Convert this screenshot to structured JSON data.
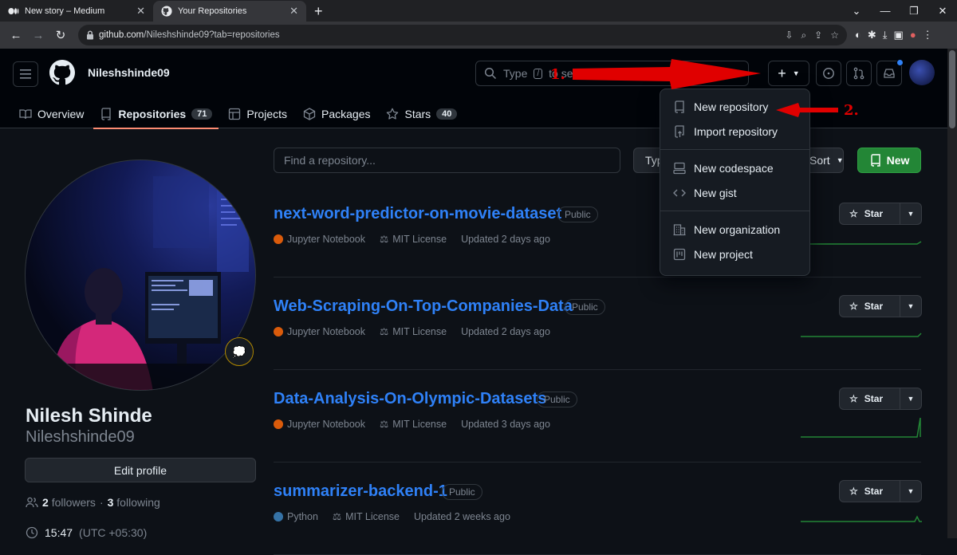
{
  "browser": {
    "tabs": [
      {
        "title": "New story – Medium",
        "icon": "medium-icon"
      },
      {
        "title": "Your Repositories",
        "icon": "github-icon",
        "active": true
      }
    ],
    "url_host": "github.com",
    "url_path": "/Nileshshinde09?tab=repositories"
  },
  "header": {
    "username": "Nileshshinde09",
    "search_placeholder_pre": "Type",
    "search_key": "/",
    "search_placeholder_post": "to search",
    "plus": "+"
  },
  "nav": {
    "tabs": [
      {
        "label": "Overview",
        "icon": "book-icon"
      },
      {
        "label": "Repositories",
        "icon": "repo-icon",
        "count": "71",
        "selected": true
      },
      {
        "label": "Projects",
        "icon": "table-icon"
      },
      {
        "label": "Packages",
        "icon": "package-icon"
      },
      {
        "label": "Stars",
        "icon": "star-icon",
        "count": "40"
      }
    ]
  },
  "profile": {
    "full_name": "Nilesh Shinde",
    "login": "Nileshshinde09",
    "edit_label": "Edit profile",
    "followers": "2",
    "followers_label": "followers",
    "sep": "·",
    "following": "3",
    "following_label": "following",
    "time": "15:47",
    "tz": "(UTC +05:30)"
  },
  "toolbar": {
    "find_placeholder": "Find a repository...",
    "type_label": "Type",
    "sort_label": "Sort",
    "new_label": "New"
  },
  "repos": [
    {
      "name": "next-word-predictor-on-movie-dataset",
      "visibility": "Public",
      "language": "Jupyter Notebook",
      "lang_color": "#DA5B0B",
      "license": "MIT License",
      "updated": "Updated 2 days ago",
      "star": "Star"
    },
    {
      "name": "Web-Scraping-On-Top-Companies-Data",
      "visibility": "Public",
      "language": "Jupyter Notebook",
      "lang_color": "#DA5B0B",
      "license": "MIT License",
      "updated": "Updated 2 days ago",
      "star": "Star"
    },
    {
      "name": "Data-Analysis-On-Olympic-Datasets",
      "visibility": "Public",
      "language": "Jupyter Notebook",
      "lang_color": "#DA5B0B",
      "license": "MIT License",
      "updated": "Updated 3 days ago",
      "star": "Star"
    },
    {
      "name": "summarizer-backend-1",
      "visibility": "Public",
      "language": "Python",
      "lang_color": "#3572A5",
      "license": "MIT License",
      "updated": "Updated 2 weeks ago",
      "star": "Star"
    }
  ],
  "menu": {
    "items": [
      {
        "label": "New repository",
        "icon": "repo-icon"
      },
      {
        "label": "Import repository",
        "icon": "repo-push-icon"
      },
      {
        "label": "New codespace",
        "icon": "codespace-icon"
      },
      {
        "label": "New gist",
        "icon": "code-icon"
      },
      {
        "label": "New organization",
        "icon": "organization-icon"
      },
      {
        "label": "New project",
        "icon": "project-icon"
      }
    ]
  },
  "annotations": {
    "step1": "1.",
    "step2": "2.",
    "color": "#e00000"
  }
}
